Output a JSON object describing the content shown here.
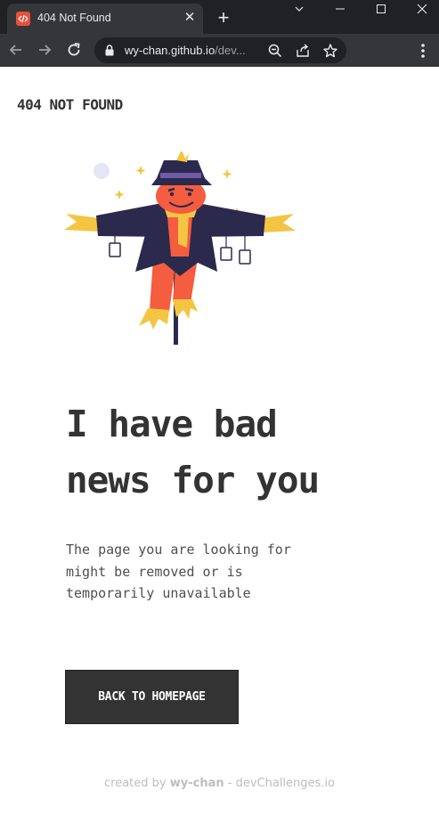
{
  "browser": {
    "tab_title": "404 Not Found",
    "url_host": "wy-chan.github.io",
    "url_path": "/dev..."
  },
  "page": {
    "brand": "404 NOT FOUND",
    "headline_line1": "I have bad",
    "headline_line2": "news for you",
    "description_line1": "The page you are looking for",
    "description_line2": "might be removed or is",
    "description_line3": "temporarily unavailable",
    "cta_label": "BACK TO HOMEPAGE",
    "footer_prefix": "created by",
    "footer_author": "wy-chan",
    "footer_suffix": "- devChallenges.io"
  },
  "colors": {
    "text_dark": "#333333",
    "footer_text": "#bdbdbd",
    "chrome_dark": "#202124",
    "chrome_mid": "#35363a",
    "favicon": "#e8503a"
  },
  "icons": [
    "scrollable-tab-list-icon",
    "minimize-icon",
    "maximize-icon",
    "close-window-icon",
    "back-icon",
    "forward-icon",
    "reload-icon",
    "lock-icon",
    "zoom-icon",
    "share-icon",
    "bookmark-star-icon",
    "kebab-menu-icon"
  ]
}
